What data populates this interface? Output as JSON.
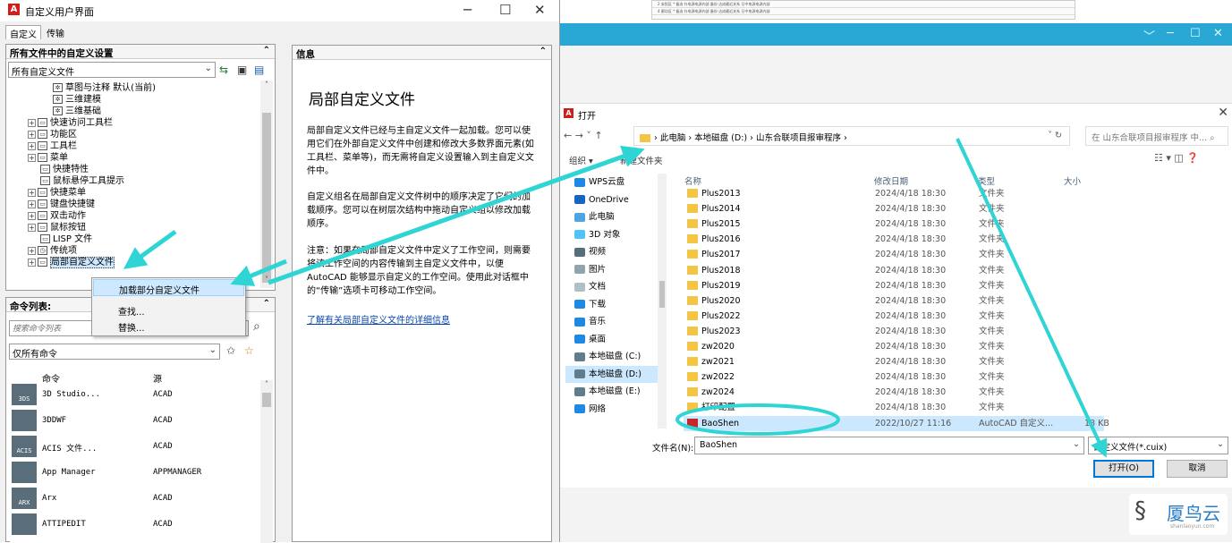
{
  "background_app": {
    "sheet_rows": [
      "2    安阳区    *    备选    针电源电源内部    备份    达成最近关系    日中电源电源内部",
      "4    廊坊区    *    备选    针电源电源内部    备份    达成最近关系    日中电源电源内部"
    ],
    "window_controls": [
      "﹀",
      "─",
      "☐",
      "✕"
    ]
  },
  "watermark": {
    "logo": "§",
    "text": "厦鸟云",
    "sub": "shanlaoyun.com"
  },
  "cui_dialog": {
    "logo": "A",
    "title": "自定义用户界面",
    "window_controls": [
      "─",
      "☐",
      "✕"
    ],
    "tabs": [
      {
        "label": "自定义"
      },
      {
        "label": "传输"
      }
    ],
    "customizations_panel": {
      "header": "所有文件中的自定义设置",
      "collapse": "⌃",
      "file_combo": "所有自定义文件",
      "tree": [
        {
          "label": "草图与注释 默认(当前)",
          "indent": 3,
          "expander": "",
          "icon": "✲"
        },
        {
          "label": "三维建模",
          "indent": 3,
          "expander": "",
          "icon": "✲"
        },
        {
          "label": "三维基础",
          "indent": 3,
          "expander": "",
          "icon": "✲"
        },
        {
          "label": "快速访问工具栏",
          "indent": 1,
          "expander": "+",
          "icon": "▭"
        },
        {
          "label": "功能区",
          "indent": 1,
          "expander": "+",
          "icon": "▭"
        },
        {
          "label": "工具栏",
          "indent": 1,
          "expander": "+",
          "icon": "▭"
        },
        {
          "label": "菜单",
          "indent": 1,
          "expander": "+",
          "icon": "▭"
        },
        {
          "label": "快捷特性",
          "indent": 2,
          "expander": "",
          "icon": "▭"
        },
        {
          "label": "鼠标悬停工具提示",
          "indent": 2,
          "expander": "",
          "icon": "▭"
        },
        {
          "label": "快捷菜单",
          "indent": 1,
          "expander": "+",
          "icon": "▭"
        },
        {
          "label": "键盘快捷键",
          "indent": 1,
          "expander": "+",
          "icon": "▭"
        },
        {
          "label": "双击动作",
          "indent": 1,
          "expander": "+",
          "icon": "▭"
        },
        {
          "label": "鼠标按钮",
          "indent": 1,
          "expander": "+",
          "icon": "▭"
        },
        {
          "label": "LISP 文件",
          "indent": 2,
          "expander": "",
          "icon": "▭"
        },
        {
          "label": "传统项",
          "indent": 1,
          "expander": "+",
          "icon": "◷"
        },
        {
          "label": "局部自定义文件",
          "indent": 1,
          "expander": "+",
          "icon": "▭",
          "selected": true
        }
      ]
    },
    "context_menu": {
      "items": [
        {
          "label": "加载部分自定义文件",
          "highlighted": true
        },
        {
          "label": "查找..."
        },
        {
          "label": "替换..."
        }
      ]
    },
    "command_list": {
      "header": "命令列表:",
      "collapse": "⌃",
      "search_placeholder": "搜索命令列表",
      "filter": "仅所有命令",
      "col_command": "命令",
      "col_source": "源",
      "rows": [
        {
          "name": "3D Studio...",
          "source": "ACAD",
          "icon_text": "3DS"
        },
        {
          "name": "3DDWF",
          "source": "ACAD",
          "icon_text": ""
        },
        {
          "name": "ACIS 文件...",
          "source": "ACAD",
          "icon_text": "ACIS"
        },
        {
          "name": "App Manager",
          "source": "APPMANAGER",
          "icon_text": ""
        },
        {
          "name": "Arx",
          "source": "ACAD",
          "icon_text": "ARX"
        },
        {
          "name": "ATTIPEDIT",
          "source": "ACAD",
          "icon_text": ""
        }
      ]
    },
    "info_panel": {
      "header": "信息",
      "collapse": "⌃",
      "title": "局部自定义文件",
      "paragraphs": [
        "局部自定义文件已经与主自定义文件一起加载。您可以使用它们在外部自定义文件中创建和修改大多数界面元素(如工具栏、菜单等)，而无需将自定义设置输入到主自定义文件中。",
        "自定义组名在局部自定义文件树中的顺序决定了它们的加载顺序。您可以在树层次结构中拖动自定义组以修改加载顺序。",
        "注意：如果在局部自定义文件中定义了工作空间，则需要将该工作空间的内容传输到主自定义文件中，以便 AutoCAD 能够显示自定义的工作空间。使用此对话框中的“传输”选项卡可移动工作空间。"
      ],
      "link": "了解有关局部自定义文件的详细信息"
    }
  },
  "open_dialog": {
    "logo": "A",
    "title": "打开",
    "close": "✕",
    "nav_arrows": "←  →  ˅  ↑",
    "breadcrumb": "›  此电脑  ›  本地磁盘 (D:)  ›  山东合联项目报审程序  ›",
    "address_controls": "˅   ↻",
    "search_placeholder": "在 山东合联项目报审程序 中...  ⌕",
    "organize": "组织 ▾",
    "new_folder": "新建文件夹",
    "view_controls": "☷ ▾   ◫   ❓",
    "nav_items": [
      {
        "label": "WPS云盘",
        "color": "#1e88e5"
      },
      {
        "label": "OneDrive",
        "color": "#1565c0"
      },
      {
        "label": "此电脑",
        "color": "#4fa3e0"
      },
      {
        "label": "3D 对象",
        "color": "#4fc3f7"
      },
      {
        "label": "视频",
        "color": "#546e7a"
      },
      {
        "label": "图片",
        "color": "#90a4ae"
      },
      {
        "label": "文档",
        "color": "#b0bec5"
      },
      {
        "label": "下载",
        "color": "#1e88e5"
      },
      {
        "label": "音乐",
        "color": "#1e88e5"
      },
      {
        "label": "桌面",
        "color": "#1e88e5"
      },
      {
        "label": "本地磁盘 (C:)",
        "color": "#607d8b"
      },
      {
        "label": "本地磁盘 (D:)",
        "color": "#607d8b",
        "selected": true
      },
      {
        "label": "本地磁盘 (E:)",
        "color": "#607d8b"
      },
      {
        "label": "网络",
        "color": "#1e88e5"
      }
    ],
    "columns": {
      "name": "名称",
      "date": "修改日期",
      "type": "类型",
      "size": "大小"
    },
    "files": [
      {
        "name": "Plus2013",
        "date": "2024/4/18 18:30",
        "type": "文件夹",
        "size": ""
      },
      {
        "name": "Plus2014",
        "date": "2024/4/18 18:30",
        "type": "文件夹",
        "size": ""
      },
      {
        "name": "Plus2015",
        "date": "2024/4/18 18:30",
        "type": "文件夹",
        "size": ""
      },
      {
        "name": "Plus2016",
        "date": "2024/4/18 18:30",
        "type": "文件夹",
        "size": ""
      },
      {
        "name": "Plus2017",
        "date": "2024/4/18 18:30",
        "type": "文件夹",
        "size": ""
      },
      {
        "name": "Plus2018",
        "date": "2024/4/18 18:30",
        "type": "文件夹",
        "size": ""
      },
      {
        "name": "Plus2019",
        "date": "2024/4/18 18:30",
        "type": "文件夹",
        "size": ""
      },
      {
        "name": "Plus2020",
        "date": "2024/4/18 18:30",
        "type": "文件夹",
        "size": ""
      },
      {
        "name": "Plus2022",
        "date": "2024/4/18 18:30",
        "type": "文件夹",
        "size": ""
      },
      {
        "name": "Plus2023",
        "date": "2024/4/18 18:30",
        "type": "文件夹",
        "size": ""
      },
      {
        "name": "zw2020",
        "date": "2024/4/18 18:30",
        "type": "文件夹",
        "size": ""
      },
      {
        "name": "zw2021",
        "date": "2024/4/18 18:30",
        "type": "文件夹",
        "size": ""
      },
      {
        "name": "zw2022",
        "date": "2024/4/18 18:30",
        "type": "文件夹",
        "size": ""
      },
      {
        "name": "zw2024",
        "date": "2024/4/18 18:30",
        "type": "文件夹",
        "size": ""
      },
      {
        "name": "打印配置",
        "date": "2024/4/18 18:30",
        "type": "文件夹",
        "size": ""
      },
      {
        "name": "BaoShen",
        "date": "2022/10/27 11:16",
        "type": "AutoCAD 自定义...",
        "size": "18 KB",
        "selected": true
      }
    ],
    "filename_label": "文件名(N):",
    "filename_value": "BaoShen",
    "filter": "自定义文件(*.cuix)",
    "open_button": "打开(O)",
    "cancel_button": "取消"
  },
  "annotation_color": "#2fd4d4"
}
